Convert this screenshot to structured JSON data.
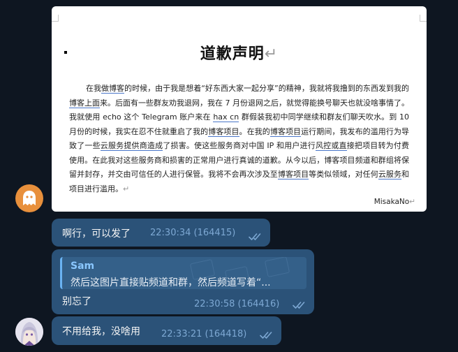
{
  "document": {
    "title": "道歉声明",
    "pilcrow": "↵",
    "body_parts": [
      "在我",
      "做博客",
      "的时候，由于我是想着“好东西大家一起分享”的精神，我就将我撸到的东西发到我的",
      "博客上面",
      "来。后面有一些群友劝我退网，我在 7 月份退网之后，就觉得能换号聊天也就没啥事情了。我就使用 echo 这个 Telegram 账户来在 ",
      "hax cn",
      " 群假装我初中同学继续和群友们聊天吹水。到 10 月份的时候，我实在忍不住就重启了我的",
      "博客项目",
      "。在我的",
      "博客项目",
      "运行期间，我发布的滥用行为导致了一些",
      "云服务提供商造成",
      "了损害。使这些服务商对中国 IP 和用户进行",
      "风控或直",
      "接把项目转为付费使用。在此我对这些服务商和损害的正常用户进行真诚的道歉。从今以后，博客项目频道和群组将保留并封存，并交由可信任的人进行保管。我将不会再次涉及至",
      "博客项目",
      "等类似领域，对任何",
      "云服务",
      "和项目进行滥用。",
      "↵"
    ],
    "empty_line": "↵",
    "signature": "MisakaNo",
    "signature_mark": "↵"
  },
  "messages": [
    {
      "text": "啊行，可以发了",
      "time": "22:30:34 (164415)",
      "status_icon": "double-check"
    },
    {
      "reply": {
        "sender": "Sam",
        "text": "然后这图片直接贴频道和群，然后频道写着“..."
      },
      "text": "别忘了",
      "time": "22:30:58 (164416)",
      "status_icon": "double-check"
    },
    {
      "text": "不用给我，没啥用",
      "time": "22:33:21 (164418)",
      "status_icon": "double-check"
    }
  ],
  "colors": {
    "background": "#0e1621",
    "bubble": "#2b5278",
    "time": "#7da8d3",
    "ghost_avatar": "#e8903c",
    "reply_accent": "#6ab3f3"
  }
}
